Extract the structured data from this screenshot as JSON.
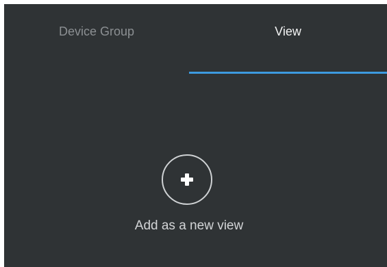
{
  "tabs": {
    "device_group": {
      "label": "Device Group",
      "selected": false
    },
    "view": {
      "label": "View",
      "selected": true
    }
  },
  "add_view": {
    "icon": "plus-icon",
    "label": "Add as a new view"
  },
  "colors": {
    "background": "#2f3335",
    "accent": "#3d9be0",
    "active_text": "#f2f3f3",
    "inactive_text": "#8c9093"
  }
}
